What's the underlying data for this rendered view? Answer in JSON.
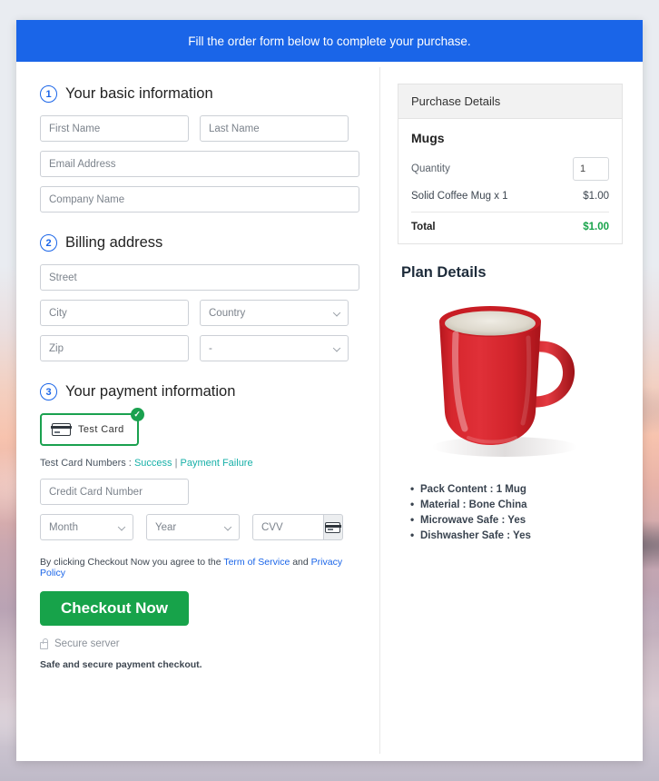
{
  "banner": {
    "text": "Fill the order form below to complete your purchase."
  },
  "sections": {
    "basic": {
      "step": "1",
      "title": "Your basic information",
      "fields": {
        "first_name": "First Name",
        "last_name": "Last Name",
        "email": "Email Address",
        "company": "Company Name"
      }
    },
    "billing": {
      "step": "2",
      "title": "Billing address",
      "fields": {
        "street": "Street",
        "city": "City",
        "country": "Country",
        "zip": "Zip",
        "state": "-"
      }
    },
    "payment": {
      "step": "3",
      "title": "Your payment information",
      "card_option_label": "Test Card",
      "badge": "✓",
      "test_numbers_prefix": "Test Card Numbers :",
      "test_numbers_success": "Success",
      "test_numbers_separator": "|",
      "test_numbers_failure": "Payment Failure",
      "fields": {
        "credit_card": "Credit Card Number",
        "month": "Month",
        "year": "Year",
        "cvv": "CVV"
      }
    }
  },
  "terms": {
    "prefix": "By clicking Checkout Now you agree to the",
    "tos": "Term of Service",
    "and": "and",
    "privacy": "Privacy Policy"
  },
  "checkout": {
    "button_label": "Checkout Now",
    "secure_label": "Secure server",
    "safe_note": "Safe and secure payment checkout."
  },
  "purchase": {
    "heading": "Purchase Details",
    "product": "Mugs",
    "quantity_label": "Quantity",
    "quantity_value": "1",
    "line_item_label": "Solid Coffee Mug x 1",
    "line_item_price": "$1.00",
    "total_label": "Total",
    "total_price": "$1.00"
  },
  "plan": {
    "title": "Plan Details",
    "features": [
      "Pack Content : 1 Mug",
      "Material : Bone China",
      "Microwave Safe : Yes",
      "Dishwasher Safe : Yes"
    ]
  },
  "colors": {
    "banner_blue": "#1a65e8",
    "accent_green": "#17a34a",
    "link_blue": "#1a65e8",
    "link_teal": "#17b0a8",
    "mug_red": "#d22027"
  }
}
